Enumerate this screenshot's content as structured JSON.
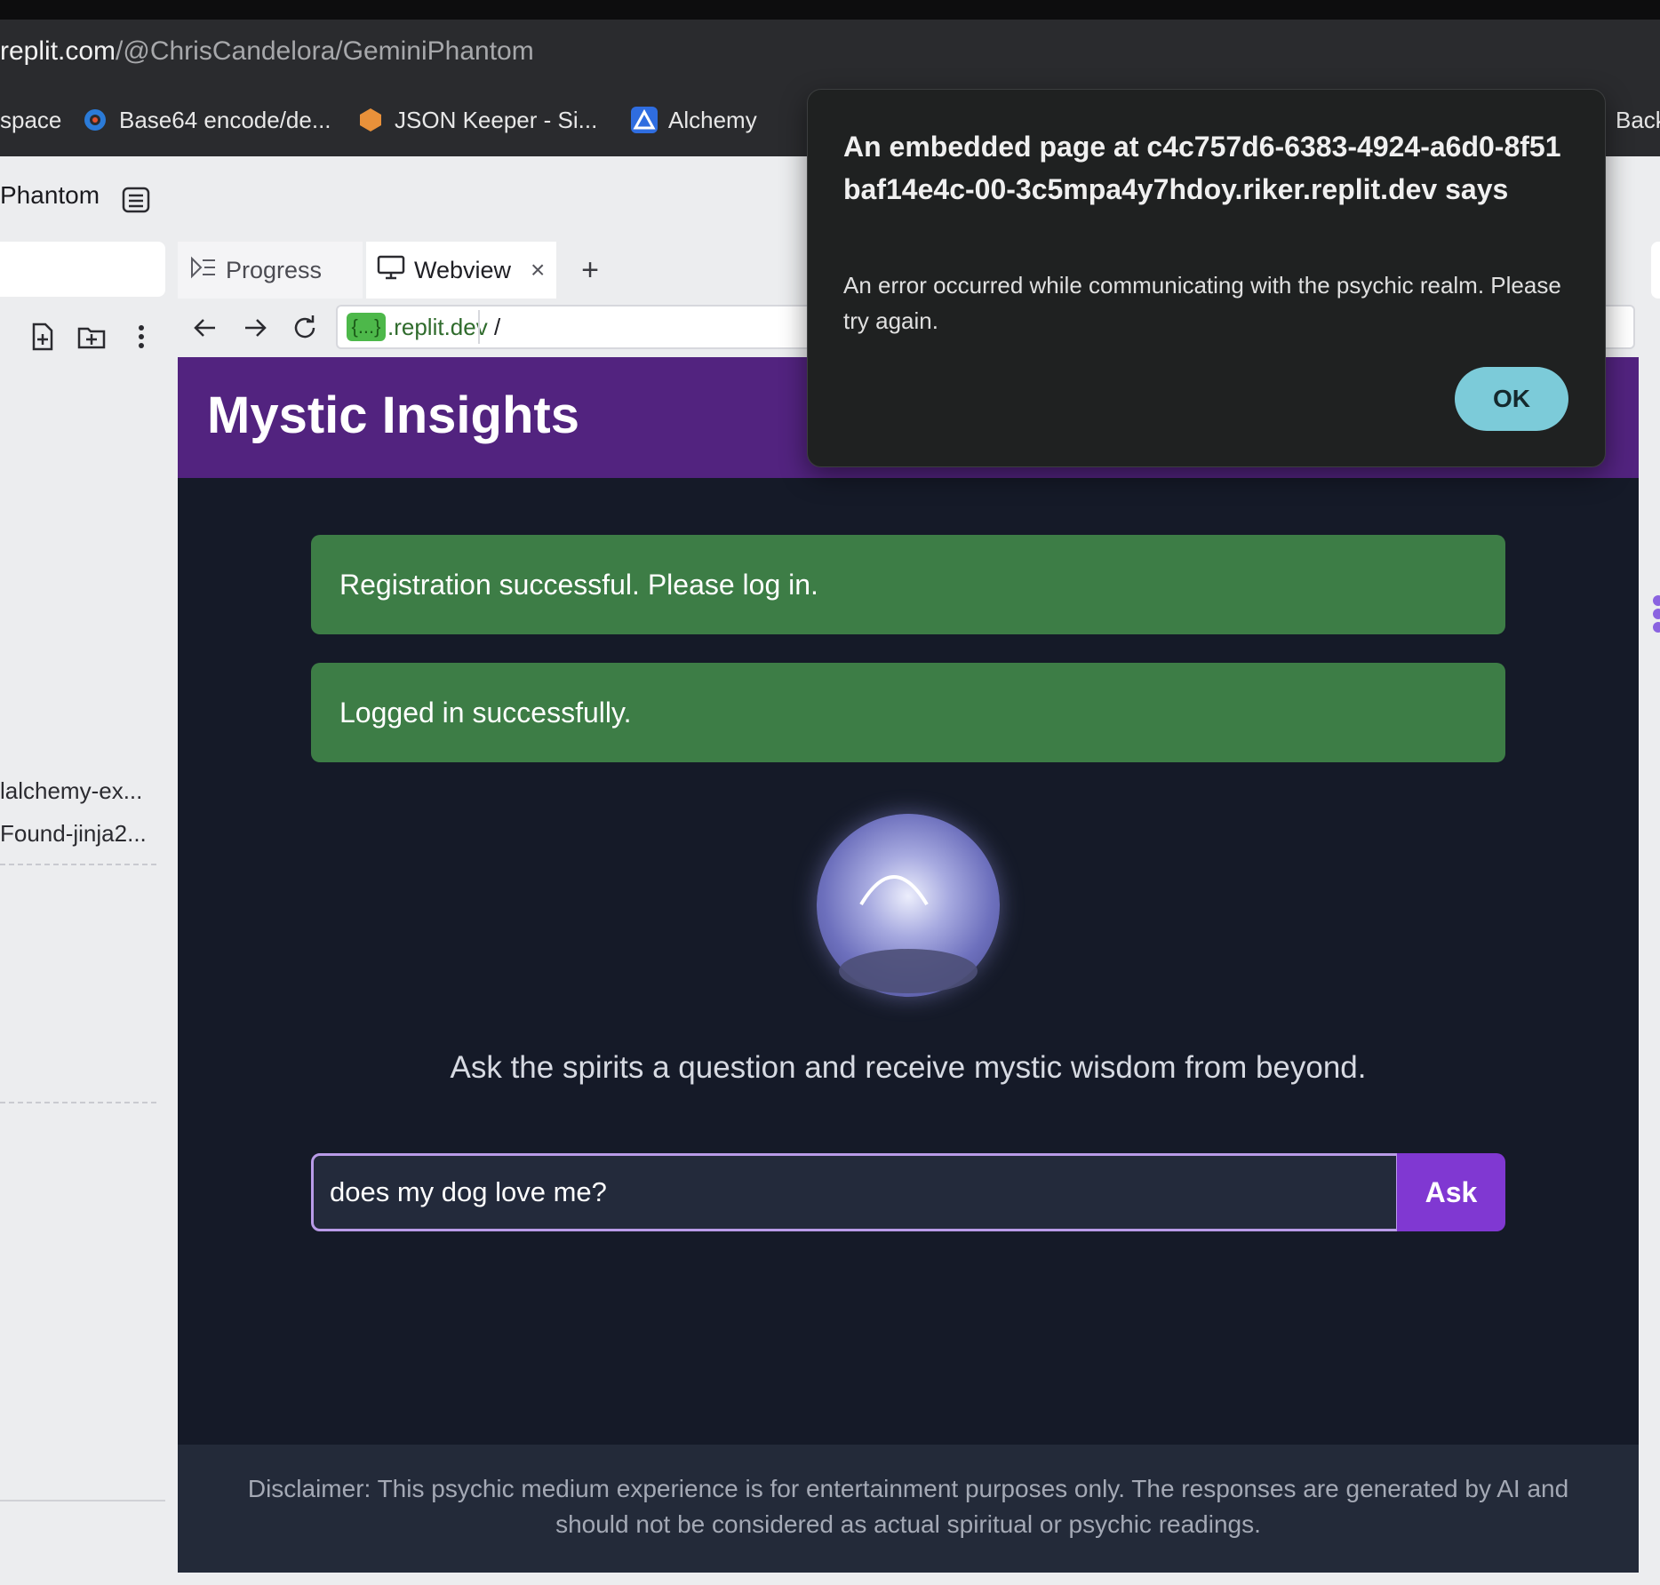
{
  "browser": {
    "url_host": "replit.com",
    "url_path": "/@ChrisCandelora/GeminiPhantom",
    "bookmarks": [
      {
        "label": "space",
        "icon": "none"
      },
      {
        "label": "Base64 encode/de...",
        "icon": "gear-icon"
      },
      {
        "label": "JSON Keeper - Si...",
        "icon": "hexagon-icon"
      },
      {
        "label": "Alchemy",
        "icon": "alchemy-icon"
      },
      {
        "label": "Back",
        "icon": "none"
      }
    ]
  },
  "workspace": {
    "title": "Phantom",
    "files": [
      "lalchemy-ex...",
      "Found-jinja2..."
    ]
  },
  "tabs": {
    "progress_label": "Progress",
    "webview_label": "Webview",
    "close_symbol": "×",
    "add_symbol": "+"
  },
  "webview": {
    "badge": "{...}",
    "host": ".replit.dev",
    "path": "/"
  },
  "app": {
    "title": "Mystic Insights",
    "alerts": [
      "Registration successful. Please log in.",
      "Logged in successfully."
    ],
    "tagline": "Ask the spirits a question and receive mystic wisdom from beyond.",
    "question_value": "does my dog love me?",
    "ask_label": "Ask",
    "disclaimer": "Disclaimer: This psychic medium experience is for entertainment purposes only. The responses are generated by AI and should not be considered as actual spiritual or psychic readings."
  },
  "dialog": {
    "title": "An embedded page at c4c757d6-6383-4924-a6d0-8f51baf14e4c-00-3c5mpa4y7hdoy.riker.replit.dev says",
    "message": "An error occurred while communicating with the psychic realm. Please try again.",
    "ok_label": "OK"
  },
  "colors": {
    "header_purple": "#52237f",
    "app_background": "#151a28",
    "alert_green": "#3d7d46",
    "ask_button": "#8038d2",
    "dialog_ok": "#7ccbd9"
  }
}
